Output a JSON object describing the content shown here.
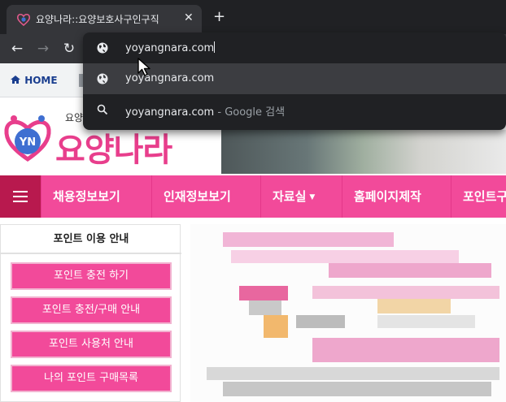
{
  "browser": {
    "tab": {
      "title": "요양나라::요양보호사구인구직",
      "close": "✕"
    },
    "new_tab": "+",
    "nav": {
      "back": "←",
      "forward": "→",
      "reload": "↻"
    },
    "omnibox": {
      "input_value": "yoyangnara.com",
      "suggestion_url": "yoyangnara.com",
      "search_query": "yoyangnara.com",
      "search_separator": " - ",
      "search_engine": "Google 검색"
    }
  },
  "bookmarks": {
    "home_label": "HOME",
    "home_icon": "home-icon"
  },
  "site": {
    "logo_small": "요양",
    "logo_text": "요양나라",
    "logo_badge": "YN"
  },
  "mainnav": {
    "items": [
      {
        "label": "채용정보보기"
      },
      {
        "label": "인재정보보기"
      },
      {
        "label": "자료실",
        "caret": "▼"
      },
      {
        "label": "홈페이지제작"
      },
      {
        "label": "포인트구"
      }
    ]
  },
  "sidebar": {
    "title": "포인트 이용 안내",
    "buttons": [
      "포인트 충전 하기",
      "포인트 충전/구매 안내",
      "포인트 사용처 안내",
      "나의 포인트 구매목록"
    ]
  },
  "colors": {
    "brand_pink": "#f24a9a",
    "nav_dark": "#b8194e",
    "chrome_bg": "#202124"
  }
}
